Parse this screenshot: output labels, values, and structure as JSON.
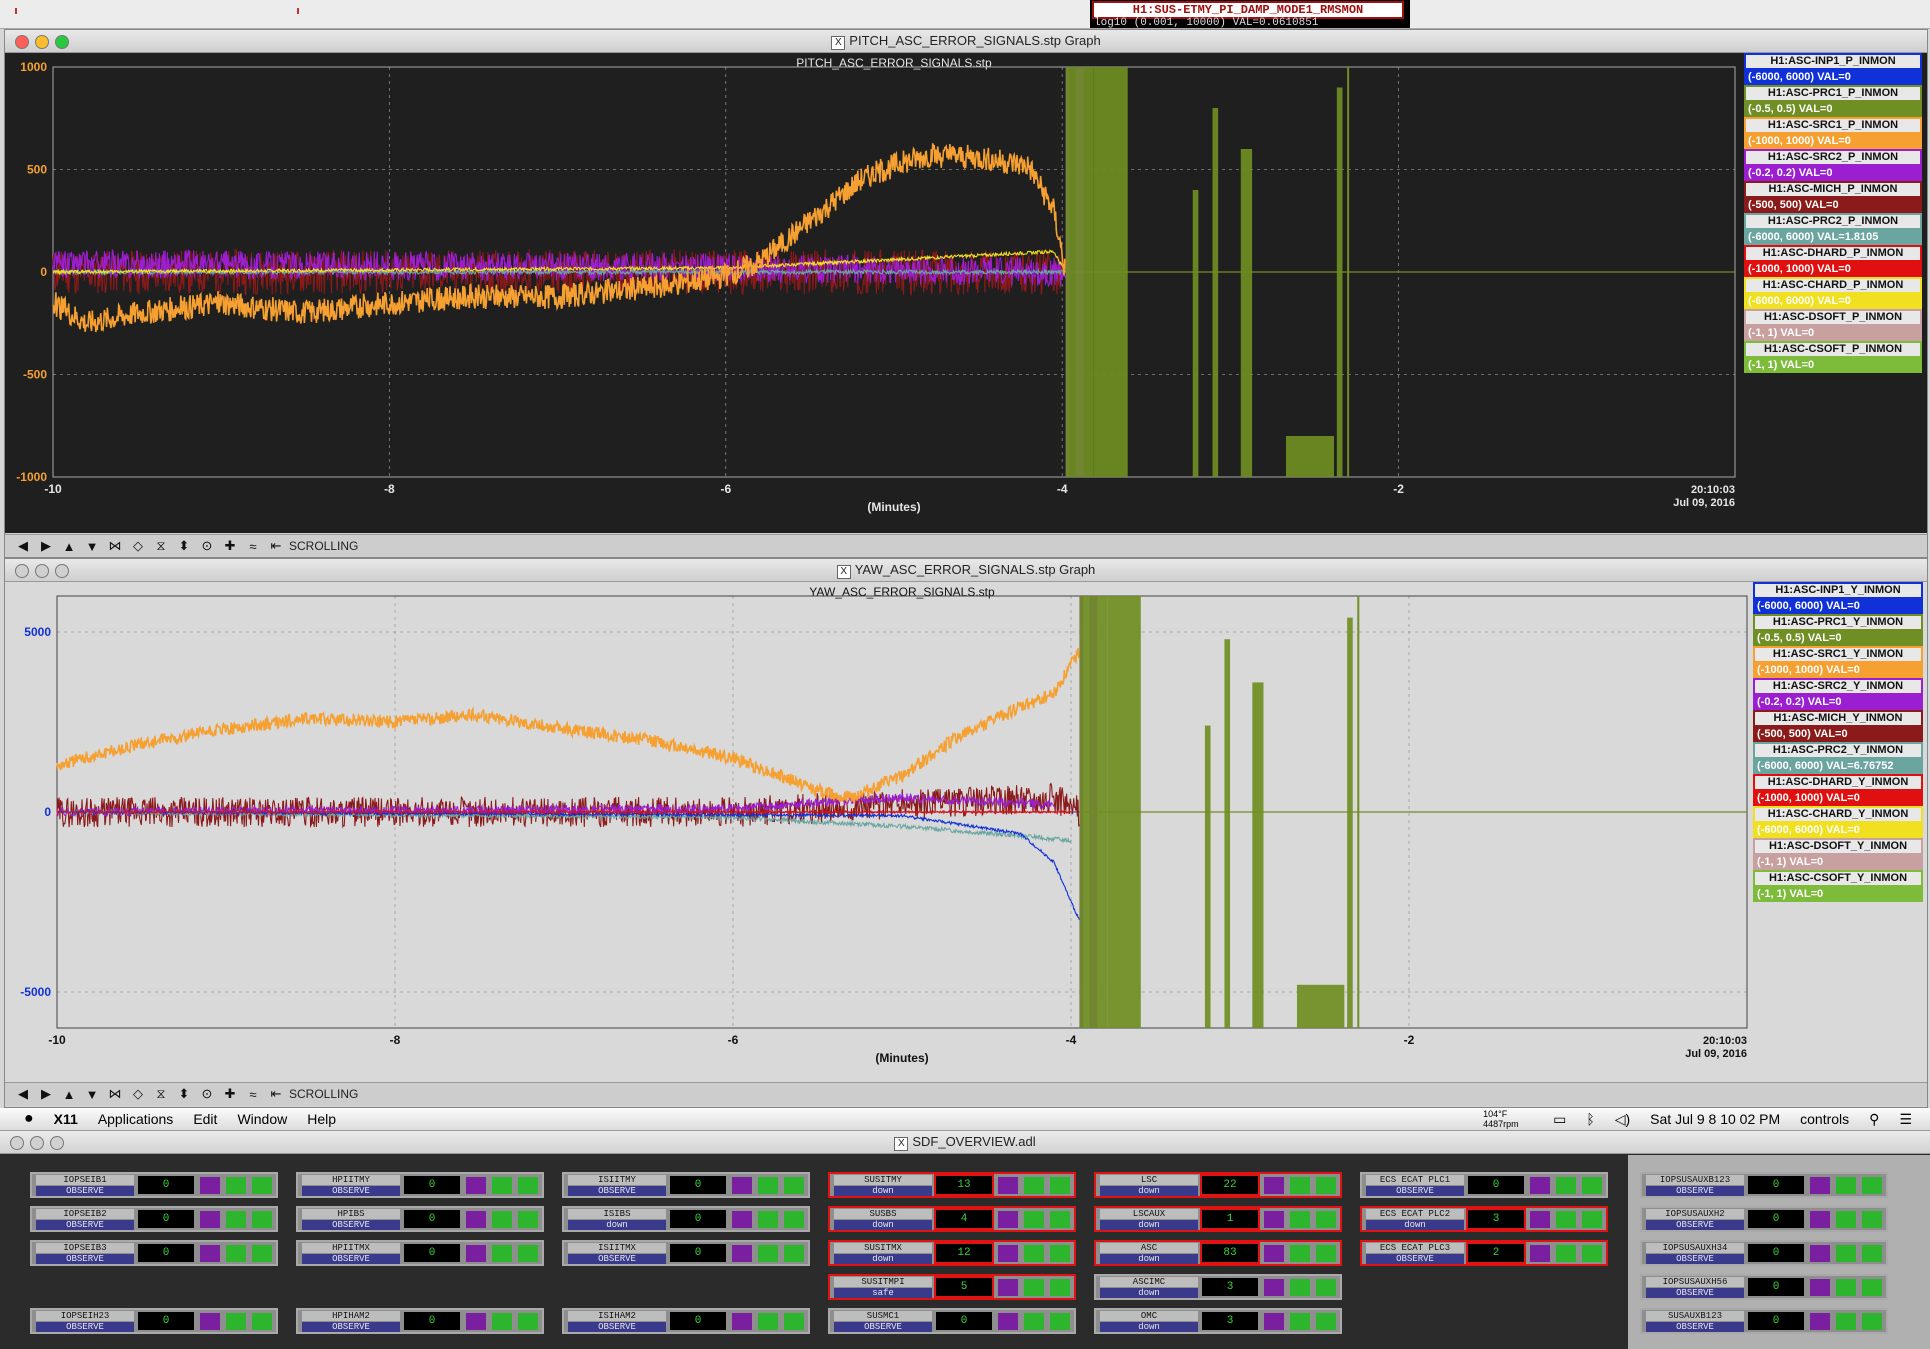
{
  "colors": {
    "plot_dark_bg": "#1f1f1f",
    "plot_light_bg": "#d9d9d9",
    "INP1": "#1030d8",
    "PRC1": "#6f8e23",
    "SRC1": "#f5a030",
    "SRC2": "#9b1fd0",
    "MICH": "#8b1a1a",
    "PRC2": "#6aa5a0",
    "DHARD": "#e01010",
    "CHARD": "#f0e020",
    "DSOFT": "#c8a0a0",
    "CSOFT": "#7dbb3a"
  },
  "top_strip": {
    "rms_title": "H1:SUS-ETMY_PI_DAMP_MODE1_RMSMON",
    "rms_value": "log10 (0.001, 10000) VAL=0.0610851"
  },
  "pitch_window": {
    "title": "PITCH_ASC_ERROR_SIGNALS.stp Graph",
    "toolbar_mode": "SCROLLING"
  },
  "yaw_window": {
    "title": "YAW_ASC_ERROR_SIGNALS.stp Graph",
    "toolbar_mode": "SCROLLING"
  },
  "chart_data": [
    {
      "type": "line",
      "title": "PITCH_ASC_ERROR_SIGNALS.stp",
      "xlabel": "(Minutes)",
      "timestamp": "20:10:03",
      "date": "Jul 09, 2016",
      "xlim": [
        -10,
        0
      ],
      "ylim": [
        -1000,
        1000
      ],
      "xticks": [
        "-10",
        "-8",
        "-6",
        "-4",
        "-2"
      ],
      "yticks": [
        "1000",
        "500",
        "0",
        "-500",
        "-1000"
      ],
      "grid": true,
      "legend_placement": "right",
      "series": [
        {
          "name": "H1:ASC-INP1_P_INMON",
          "range": "(-6000, 6000) VAL=0",
          "key": "INP1"
        },
        {
          "name": "H1:ASC-PRC1_P_INMON",
          "range": "(-0.5, 0.5) VAL=0",
          "key": "PRC1"
        },
        {
          "name": "H1:ASC-SRC1_P_INMON",
          "range": "(-1000, 1000) VAL=0",
          "key": "SRC1"
        },
        {
          "name": "H1:ASC-SRC2_P_INMON",
          "range": "(-0.2, 0.2) VAL=0",
          "key": "SRC2"
        },
        {
          "name": "H1:ASC-MICH_P_INMON",
          "range": "(-500, 500) VAL=0",
          "key": "MICH"
        },
        {
          "name": "H1:ASC-PRC2_P_INMON",
          "range": "(-6000, 6000) VAL=1.8105",
          "key": "PRC2"
        },
        {
          "name": "H1:ASC-DHARD_P_INMON",
          "range": "(-1000, 1000) VAL=0",
          "key": "DHARD"
        },
        {
          "name": "H1:ASC-CHARD_P_INMON",
          "range": "(-6000, 6000) VAL=0",
          "key": "CHARD"
        },
        {
          "name": "H1:ASC-DSOFT_P_INMON",
          "range": "(-1, 1) VAL=0",
          "key": "DSOFT"
        },
        {
          "name": "H1:ASC-CSOFT_P_INMON",
          "range": "(-1, 1) VAL=0",
          "key": "CSOFT"
        }
      ],
      "traces": {
        "SRC1": {
          "x": [
            -10,
            -9.8,
            -9.5,
            -9,
            -8.5,
            -8,
            -7.5,
            -7,
            -6.5,
            -6,
            -5.8,
            -5.5,
            -5.2,
            -5,
            -4.8,
            -4.5,
            -4.2,
            -4.05,
            -3.98
          ],
          "y": [
            -150,
            -250,
            -200,
            -150,
            -200,
            -150,
            -120,
            -120,
            -80,
            -20,
            50,
            250,
            450,
            520,
            570,
            560,
            520,
            300,
            0
          ],
          "noise": 60
        },
        "SRC2": {
          "x": [
            -10,
            -6,
            -4,
            -3.98
          ],
          "y": [
            40,
            20,
            0,
            0
          ],
          "noise": 70
        },
        "MICH": {
          "x": [
            -10,
            -6,
            -4,
            -3.98
          ],
          "y": [
            0,
            0,
            0,
            0
          ],
          "noise": 110
        },
        "CHARD": {
          "x": [
            -10,
            -6,
            -5,
            -4.05,
            -3.98
          ],
          "y": [
            0,
            20,
            60,
            100,
            0
          ],
          "noise": 8
        },
        "PRC2": {
          "x": [
            -10,
            -6,
            -4.05,
            -3.98
          ],
          "y": [
            0,
            0,
            0,
            0
          ],
          "noise": 10
        }
      },
      "dropout_start_minutes": -3.98,
      "dropout_end_minutes": -2.3
    },
    {
      "type": "line",
      "title": "YAW_ASC_ERROR_SIGNALS.stp",
      "xlabel": "(Minutes)",
      "timestamp": "20:10:03",
      "date": "Jul 09, 2016",
      "xlim": [
        -10,
        0
      ],
      "ylim": [
        -6000,
        6000
      ],
      "xticks": [
        "-10",
        "-8",
        "-6",
        "-4",
        "-2"
      ],
      "yticks": [
        "5000",
        "0",
        "-5000"
      ],
      "grid": true,
      "legend_placement": "right",
      "series": [
        {
          "name": "H1:ASC-INP1_Y_INMON",
          "range": "(-6000, 6000) VAL=0",
          "key": "INP1"
        },
        {
          "name": "H1:ASC-PRC1_Y_INMON",
          "range": "(-0.5, 0.5) VAL=0",
          "key": "PRC1"
        },
        {
          "name": "H1:ASC-SRC1_Y_INMON",
          "range": "(-1000, 1000) VAL=0",
          "key": "SRC1"
        },
        {
          "name": "H1:ASC-SRC2_Y_INMON",
          "range": "(-0.2, 0.2) VAL=0",
          "key": "SRC2"
        },
        {
          "name": "H1:ASC-MICH_Y_INMON",
          "range": "(-500, 500) VAL=0",
          "key": "MICH"
        },
        {
          "name": "H1:ASC-PRC2_Y_INMON",
          "range": "(-6000, 6000) VAL=6.76752",
          "key": "PRC2"
        },
        {
          "name": "H1:ASC-DHARD_Y_INMON",
          "range": "(-1000, 1000) VAL=0",
          "key": "DHARD"
        },
        {
          "name": "H1:ASC-CHARD_Y_INMON",
          "range": "(-6000, 6000) VAL=0",
          "key": "CHARD"
        },
        {
          "name": "H1:ASC-DSOFT_Y_INMON",
          "range": "(-1, 1) VAL=0",
          "key": "DSOFT"
        },
        {
          "name": "H1:ASC-CSOFT_Y_INMON",
          "range": "(-1, 1) VAL=0",
          "key": "CSOFT"
        }
      ],
      "traces": {
        "SRC1": {
          "x": [
            -10,
            -9.5,
            -9,
            -8.5,
            -8,
            -7.5,
            -7,
            -6.5,
            -6,
            -5.5,
            -5.3,
            -5,
            -4.7,
            -4.4,
            -4.1,
            -3.95
          ],
          "y": [
            1300,
            1900,
            2300,
            2600,
            2500,
            2700,
            2300,
            2000,
            1500,
            600,
            400,
            1000,
            2000,
            2700,
            3300,
            4500
          ],
          "noise": 180
        },
        "MICH": {
          "x": [
            -10,
            -6,
            -4.1,
            -3.95
          ],
          "y": [
            0,
            0,
            400,
            0
          ],
          "noise": 420
        },
        "INP1": {
          "x": [
            -10,
            -5,
            -4.3,
            -4.1,
            -4,
            -3.95
          ],
          "y": [
            0,
            -100,
            -600,
            -1400,
            -2500,
            -3000
          ],
          "noise": 40
        },
        "PRC2": {
          "x": [
            -10,
            -6,
            -5,
            -4.2,
            -4
          ],
          "y": [
            0,
            -150,
            -400,
            -700,
            -800
          ],
          "noise": 60
        },
        "SRC2": {
          "x": [
            -10,
            -6,
            -5,
            -4.5,
            -4.1
          ],
          "y": [
            0,
            100,
            400,
            300,
            200
          ],
          "noise": 120
        },
        "DHARD": {
          "x": [
            -10,
            -4
          ],
          "y": [
            0,
            0
          ],
          "noise": 30
        }
      },
      "dropout_start_minutes": -3.95,
      "dropout_end_minutes": -2.3
    }
  ],
  "menubar": {
    "app": "X11",
    "items": [
      "Applications",
      "Edit",
      "Window",
      "Help"
    ],
    "temp": "104°F",
    "rpm": "4487rpm",
    "clock": "Sat Jul 9  8 10 02 PM",
    "user": "controls"
  },
  "sdf": {
    "title": "SDF_OVERVIEW.adl",
    "cells": [
      {
        "name": "IOPSEIB1",
        "state": "OBSERVE",
        "count": "0",
        "alarm": false
      },
      {
        "name": "IOPSEIB2",
        "state": "OBSERVE",
        "count": "0",
        "alarm": false
      },
      {
        "name": "IOPSEIB3",
        "state": "OBSERVE",
        "count": "0",
        "alarm": false
      },
      {
        "name": "IOPSEIH23",
        "state": "OBSERVE",
        "count": "0",
        "alarm": false
      },
      {
        "name": "HPIITMY",
        "state": "OBSERVE",
        "count": "0",
        "alarm": false
      },
      {
        "name": "HPIBS",
        "state": "OBSERVE",
        "count": "0",
        "alarm": false
      },
      {
        "name": "HPIITMX",
        "state": "OBSERVE",
        "count": "0",
        "alarm": false
      },
      {
        "name": "HPIHAM2",
        "state": "OBSERVE",
        "count": "0",
        "alarm": false
      },
      {
        "name": "ISIITMY",
        "state": "OBSERVE",
        "count": "0",
        "alarm": false
      },
      {
        "name": "ISIBS",
        "state": "down",
        "count": "0",
        "alarm": false
      },
      {
        "name": "ISIITMX",
        "state": "OBSERVE",
        "count": "0",
        "alarm": false
      },
      {
        "name": "ISIHAM2",
        "state": "OBSERVE",
        "count": "0",
        "alarm": false
      },
      {
        "name": "SUSITMY",
        "state": "down",
        "count": "13",
        "alarm": true
      },
      {
        "name": "SUSBS",
        "state": "down",
        "count": "4",
        "alarm": true
      },
      {
        "name": "SUSITMX",
        "state": "down",
        "count": "12",
        "alarm": true
      },
      {
        "name": "SUSITMPI",
        "state": "safe",
        "count": "5",
        "alarm": true
      },
      {
        "name": "SUSMC1",
        "state": "OBSERVE",
        "count": "0",
        "alarm": false
      },
      {
        "name": "LSC",
        "state": "down",
        "count": "22",
        "alarm": true
      },
      {
        "name": "LSCAUX",
        "state": "down",
        "count": "1",
        "alarm": true
      },
      {
        "name": "ASC",
        "state": "down",
        "count": "83",
        "alarm": true
      },
      {
        "name": "ASCIMC",
        "state": "down",
        "count": "3",
        "alarm": false
      },
      {
        "name": "OMC",
        "state": "down",
        "count": "3",
        "alarm": false
      },
      {
        "name": "ECS ECAT PLC1",
        "state": "OBSERVE",
        "count": "0",
        "alarm": false
      },
      {
        "name": "ECS ECAT PLC2",
        "state": "down",
        "count": "3",
        "alarm": true
      },
      {
        "name": "ECS ECAT PLC3",
        "state": "OBSERVE",
        "count": "2",
        "alarm": true
      },
      {
        "name": "IOPSUSAUXB123",
        "state": "OBSERVE",
        "count": "0",
        "alarm": false
      },
      {
        "name": "IOPSUSAUXH2",
        "state": "OBSERVE",
        "count": "0",
        "alarm": false
      },
      {
        "name": "IOPSUSAUXH34",
        "state": "OBSERVE",
        "count": "0",
        "alarm": false
      },
      {
        "name": "IOPSUSAUXH56",
        "state": "OBSERVE",
        "count": "0",
        "alarm": false
      },
      {
        "name": "SUSAUXB123",
        "state": "OBSERVE",
        "count": "0",
        "alarm": false
      }
    ]
  }
}
